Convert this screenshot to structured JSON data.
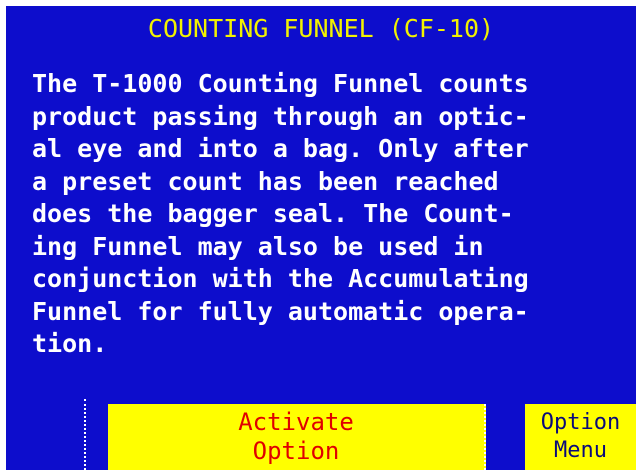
{
  "screen": {
    "title": "COUNTING FUNNEL (CF-10)",
    "description_lines": [
      "The T-1000 Counting Funnel counts",
      "product passing through an optic-",
      "al eye and into a bag. Only after",
      "a preset  count has been  reached",
      "does the  bagger seal. The Count-",
      "ing  Funnel may  also be  used in",
      "conjunction with the Accumulating",
      "Funnel for fully automatic opera-",
      "tion."
    ]
  },
  "buttons": {
    "activate": {
      "line1": "Activate",
      "line2": "Option"
    },
    "option_menu": {
      "line1": "Option",
      "line2": "Menu"
    }
  },
  "colors": {
    "background": "#0d0dcc",
    "title": "#f2f200",
    "body_text": "#ffffff",
    "button_bg": "#ffff00",
    "activate_text": "#e00000",
    "menu_text": "#0a0a7a"
  }
}
